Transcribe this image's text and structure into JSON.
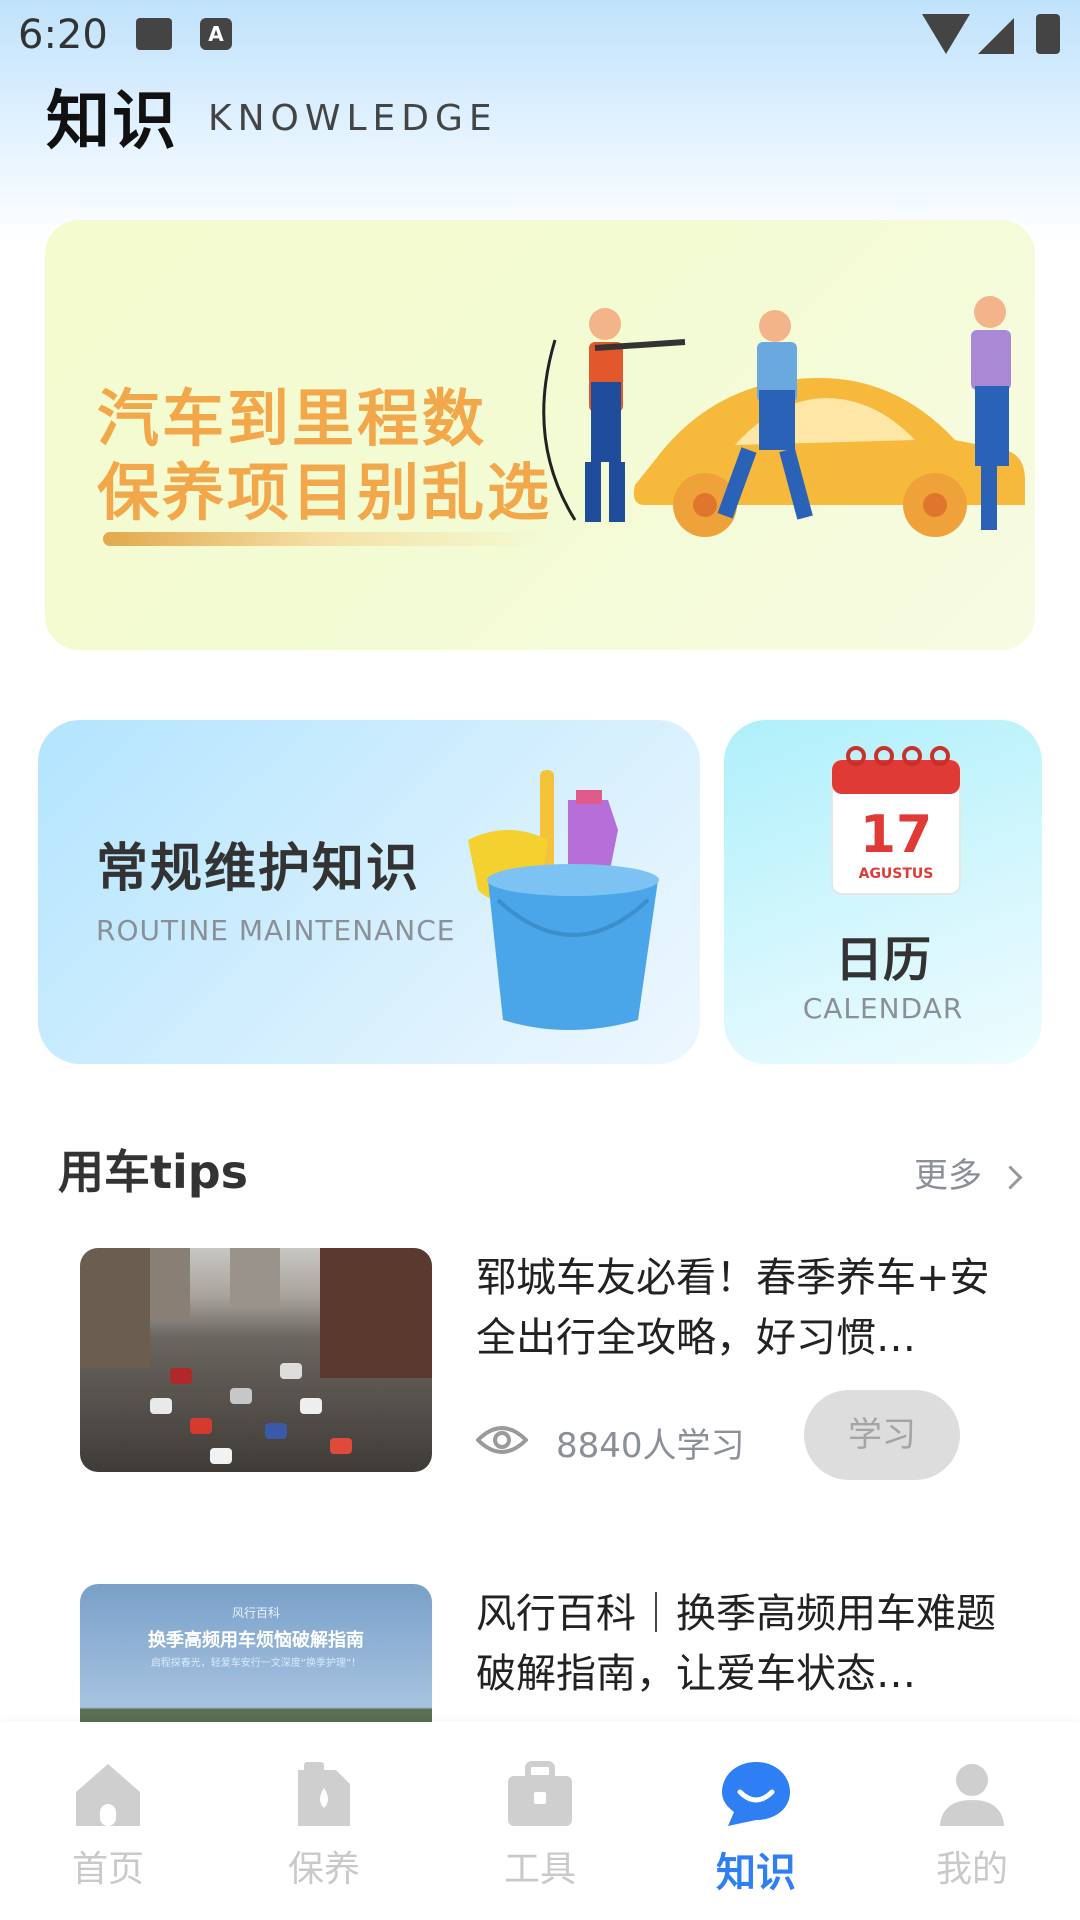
{
  "status_bar": {
    "time": "6:20",
    "notif_letter": "A"
  },
  "header": {
    "title": "知识",
    "subtitle": "KNOWLEDGE"
  },
  "banner": {
    "line1": "汽车到里程数",
    "line2": "保养项目别乱选"
  },
  "cards": {
    "routine": {
      "title": "常规维护知识",
      "subtitle": "ROUTINE MAINTENANCE"
    },
    "calendar": {
      "title": "日历",
      "subtitle": "CALENDAR",
      "day": "17",
      "month": "AGUSTUS"
    }
  },
  "tips": {
    "title": "用车tips",
    "more": "更多",
    "articles": [
      {
        "title": "郓城车友必看！春季养车+安全出行全攻略，好习惯…",
        "views": "8840人学习",
        "action": "学习"
      },
      {
        "title": "风行百科｜换季高频用车难题破解指南，让爱车状态…",
        "thumb_brand": "风行百科",
        "thumb_title": "换季高频用车烦恼破解指南",
        "thumb_sub": "启程探春光，轻爱车安行一文深度“换季护理”！"
      }
    ]
  },
  "nav": {
    "items": [
      {
        "label": "首页",
        "icon": "home-icon"
      },
      {
        "label": "保养",
        "icon": "oil-can-icon"
      },
      {
        "label": "工具",
        "icon": "toolbox-icon"
      },
      {
        "label": "知识",
        "icon": "knowledge-icon",
        "active": true
      },
      {
        "label": "我的",
        "icon": "user-icon"
      }
    ]
  },
  "colors": {
    "accent": "#2d7ff3",
    "banner_text": "#f2a84a"
  }
}
